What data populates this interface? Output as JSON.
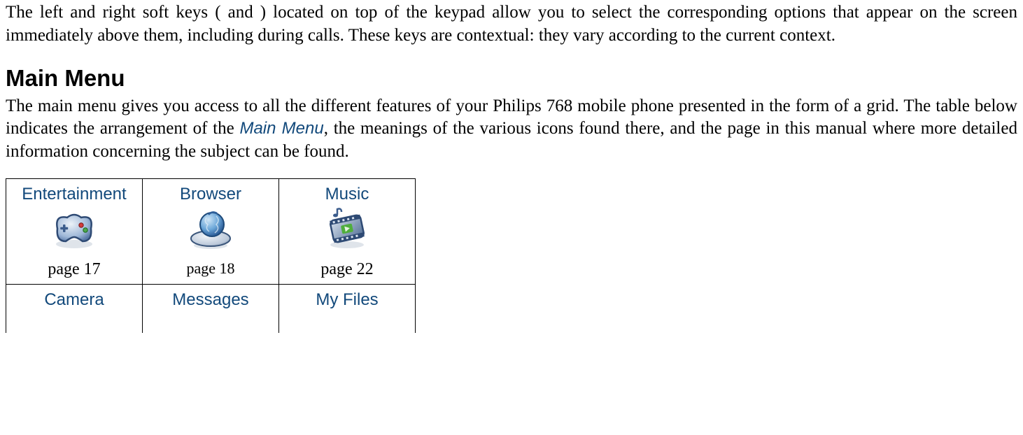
{
  "paragraph1": "The left and right soft keys (    and    ) located on top of the keypad allow you to select the corresponding options that appear on the screen immediately above them, including during calls. These keys are contextual: they vary according to the current context.",
  "heading": "Main Menu",
  "paragraph2_a": "The main menu gives you access to all the different features of your Philips 768 mobile phone presented in the form of a grid. The table below indicates the arrangement of the ",
  "paragraph2_menu": "Main Menu",
  "paragraph2_b": ", the meanings of the various icons found there, and the page in this manual where more detailed information concerning the subject can be found.",
  "table": {
    "row1": [
      {
        "title": "Entertainment",
        "page": "page 17"
      },
      {
        "title": "Browser",
        "page": "page 18"
      },
      {
        "title": "Music",
        "page": "page 22"
      }
    ],
    "row2": [
      {
        "title": "Camera"
      },
      {
        "title": "Messages"
      },
      {
        "title": "My Files"
      }
    ]
  }
}
